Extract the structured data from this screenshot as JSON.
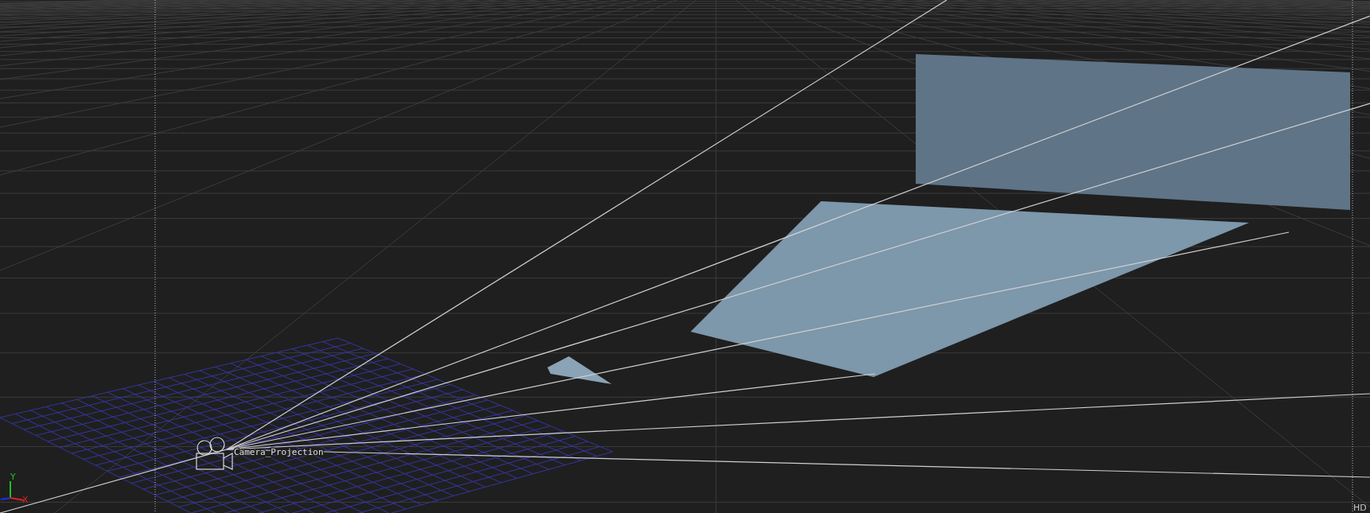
{
  "viewport": {
    "camera": {
      "label": "Camera_Projection"
    },
    "axis_labels": [
      {
        "kind": "x",
        "text": "X"
      },
      {
        "kind": "y",
        "text": "Y"
      }
    ],
    "format": "HD"
  }
}
